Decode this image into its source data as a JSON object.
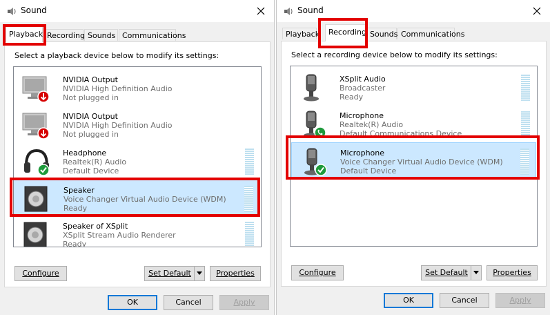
{
  "highlight_color": "#e30000",
  "playback_dialog": {
    "title": "Sound",
    "tabs": [
      "Playback",
      "Recording",
      "Sounds",
      "Communications"
    ],
    "active_tab": "Playback",
    "instruction": "Select a playback device below to modify its settings:",
    "devices": [
      {
        "name": "NVIDIA Output",
        "driver": "NVIDIA High Definition Audio",
        "status": "Not plugged in",
        "icon": "monitor-icon",
        "badge": "red-down-arrow-badge",
        "selected": false
      },
      {
        "name": "NVIDIA Output",
        "driver": "NVIDIA High Definition Audio",
        "status": "Not plugged in",
        "icon": "monitor-icon",
        "badge": "red-down-arrow-badge",
        "selected": false
      },
      {
        "name": "Headphone",
        "driver": "Realtek(R) Audio",
        "status": "Default Device",
        "icon": "headphone-icon",
        "badge": "green-check-badge",
        "selected": false
      },
      {
        "name": "Speaker",
        "driver": "Voice Changer Virtual Audio Device (WDM)",
        "status": "Ready",
        "icon": "speaker-icon",
        "badge": "",
        "selected": true
      },
      {
        "name": "Speaker of XSplit",
        "driver": "XSplit  Stream  Audio  Renderer",
        "status": "Ready",
        "icon": "speaker-icon",
        "badge": "",
        "selected": false
      }
    ],
    "buttons": {
      "configure": "Configure",
      "set_default": "Set Default",
      "properties": "Properties",
      "ok": "OK",
      "cancel": "Cancel",
      "apply": "Apply"
    }
  },
  "recording_dialog": {
    "title": "Sound",
    "tabs": [
      "Playback",
      "Recording",
      "Sounds",
      "Communications"
    ],
    "active_tab": "Recording",
    "instruction": "Select a recording device below to modify its settings:",
    "devices": [
      {
        "name": "XSplit Audio",
        "driver": "Broadcaster",
        "status": "Ready",
        "icon": "microphone-icon",
        "badge": "",
        "selected": false
      },
      {
        "name": "Microphone",
        "driver": "Realtek(R) Audio",
        "status": "Default Communications Device",
        "icon": "microphone-icon",
        "badge": "green-phone-badge",
        "selected": false
      },
      {
        "name": "Microphone",
        "driver": "Voice Changer Virtual Audio Device (WDM)",
        "status": "Default Device",
        "icon": "microphone-icon",
        "badge": "green-check-badge",
        "selected": true
      }
    ],
    "buttons": {
      "configure": "Configure",
      "set_default": "Set Default",
      "properties": "Properties",
      "ok": "OK",
      "cancel": "Cancel",
      "apply": "Apply"
    }
  }
}
